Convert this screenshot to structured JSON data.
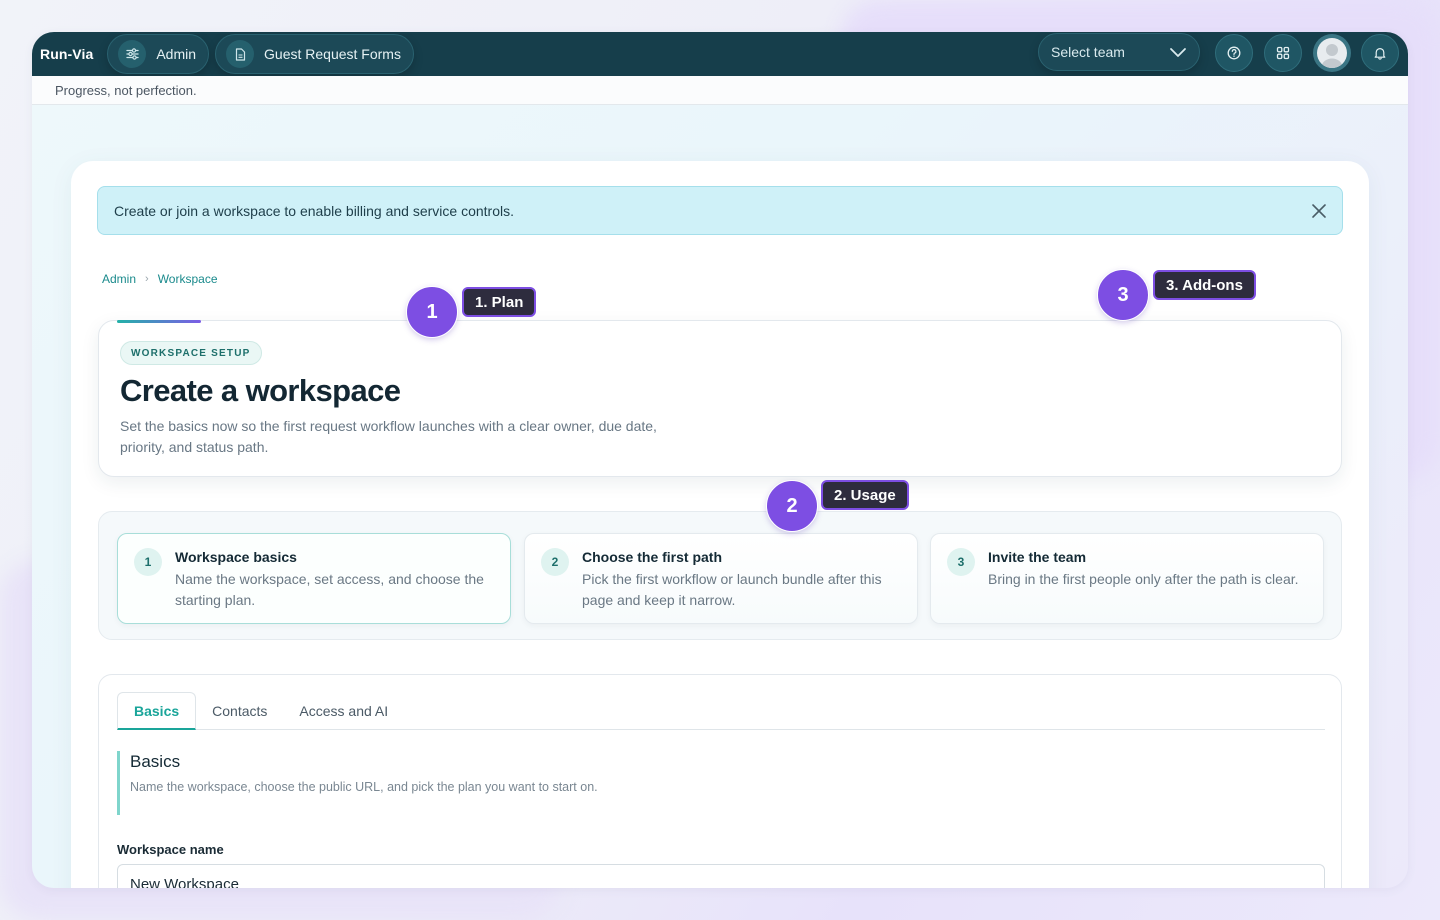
{
  "topbar": {
    "brand": "Run-Via",
    "nav": [
      {
        "label": "Admin",
        "icon": "sliders-icon"
      },
      {
        "label": "Guest Request Forms",
        "icon": "document-icon"
      }
    ],
    "team_select": {
      "value": "Select team",
      "icon": "chevron-down-icon"
    },
    "icons": [
      "help-icon",
      "apps-grid-icon",
      "avatar",
      "bell-icon"
    ]
  },
  "subbar": {
    "tagline": "Progress, not perfection."
  },
  "alert": {
    "text": "Create or join a workspace to enable billing and service controls."
  },
  "breadcrumb": {
    "items": [
      "Admin",
      "Workspace"
    ]
  },
  "hero": {
    "badge": "WORKSPACE SETUP",
    "title": "Create a workspace",
    "description": "Set the basics now so the first request workflow launches with a clear owner, due date, priority, and status path."
  },
  "steps": [
    {
      "number": "1",
      "title": "Workspace basics",
      "description": "Name the workspace, set access, and choose the starting plan."
    },
    {
      "number": "2",
      "title": "Choose the first path",
      "description": "Pick the first workflow or launch bundle after this page and keep it narrow."
    },
    {
      "number": "3",
      "title": "Invite the team",
      "description": "Bring in the first people only after the path is clear."
    }
  ],
  "tabs": [
    "Basics",
    "Contacts",
    "Access and AI"
  ],
  "section": {
    "title": "Basics",
    "description": "Name the workspace, choose the public URL, and pick the plan you want to start on."
  },
  "fields": {
    "workspace_name": {
      "label": "Workspace name",
      "value": "New Workspace"
    }
  },
  "callouts": [
    {
      "number": "1",
      "label": "1. Plan"
    },
    {
      "number": "2",
      "label": "2. Usage"
    },
    {
      "number": "3",
      "label": "3. Add-ons"
    }
  ],
  "colors": {
    "topbar": "#163e4b",
    "accent": "#1aa59a",
    "callout": "#7d4ee3",
    "alert": "#cff1f8"
  }
}
